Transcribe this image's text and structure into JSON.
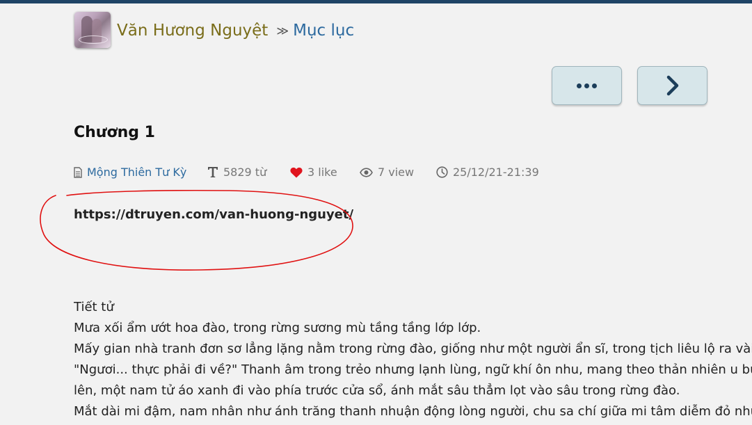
{
  "header": {
    "book_title": "Văn Hương Nguyệt",
    "separator": "≫",
    "toc_label": "Mục lục",
    "cover_icon": "book-cover-image"
  },
  "nav": {
    "more_icon": "ellipsis-icon",
    "next_icon": "chevron-right-icon"
  },
  "chapter": {
    "title": "Chương 1",
    "meta": {
      "author": "Mộng Thiên Tư Kỳ",
      "word_count": "5829 từ",
      "likes": "3 like",
      "views": "7 view",
      "timestamp": "25/12/21-21:39"
    },
    "source_url": "https://dtruyen.com/van-huong-nguyet/",
    "paragraphs": [
      "Tiết tử",
      "Mưa xối ẩm ướt hoa đào, trong rừng sương mù tầng tầng lớp lớp.",
      "Mấy gian nhà tranh đơn sơ lẳng lặng nằm trong rừng đào, giống như một người ẩn sĩ, trong tịch liêu lộ ra vài p",
      "\"Ngươi... thực phải đi về?\" Thanh âm trong trẻo nhưng lạnh lùng, ngữ khí ôn nhu, mang theo thản nhiên u buồ",
      "lên, một nam tử áo xanh đi vào phía trước cửa sổ, ánh mắt sâu thẳm lọt vào sâu trong rừng đào.",
      "Mắt dài mi đậm, nam nhân như ánh trăng thanh nhuận động lòng người, chu sa chí giữa mi tâm diễm đỏ như"
    ]
  },
  "colors": {
    "topbar": "#1f4466",
    "book_title": "#7a6d1a",
    "link": "#2d6a9f",
    "button_bg": "#d7e6ea",
    "heart": "#e0141e",
    "annotation": "#e01010"
  }
}
